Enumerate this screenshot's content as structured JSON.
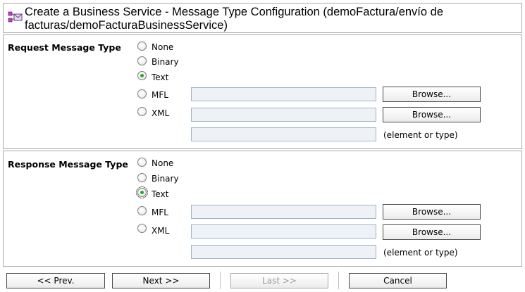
{
  "header": {
    "icon": "business-service-icon",
    "title": "Create a Business Service - Message Type Configuration (demoFactura/envío de facturas/demoFacturaBusinessService)"
  },
  "request": {
    "label": "Request Message Type",
    "options": [
      "None",
      "Binary",
      "Text",
      "MFL",
      "XML"
    ],
    "selected": "Text",
    "mfl_value": "",
    "xml_value": "",
    "element_value": "",
    "browse_label": "Browse...",
    "element_hint": "(element or type)"
  },
  "response": {
    "label": "Response Message Type",
    "options": [
      "None",
      "Binary",
      "Text",
      "MFL",
      "XML"
    ],
    "selected": "Text",
    "mfl_value": "",
    "xml_value": "",
    "element_value": "",
    "browse_label": "Browse...",
    "element_hint": "(element or type)"
  },
  "nav": {
    "prev_label": "<< Prev.",
    "next_label": "Next >>",
    "last_label": "Last >>",
    "cancel_label": "Cancel"
  },
  "colors": {
    "radio_checked": "#26a52b",
    "field_bg": "#eef2f6",
    "disabled_text": "#9a9a9a"
  }
}
